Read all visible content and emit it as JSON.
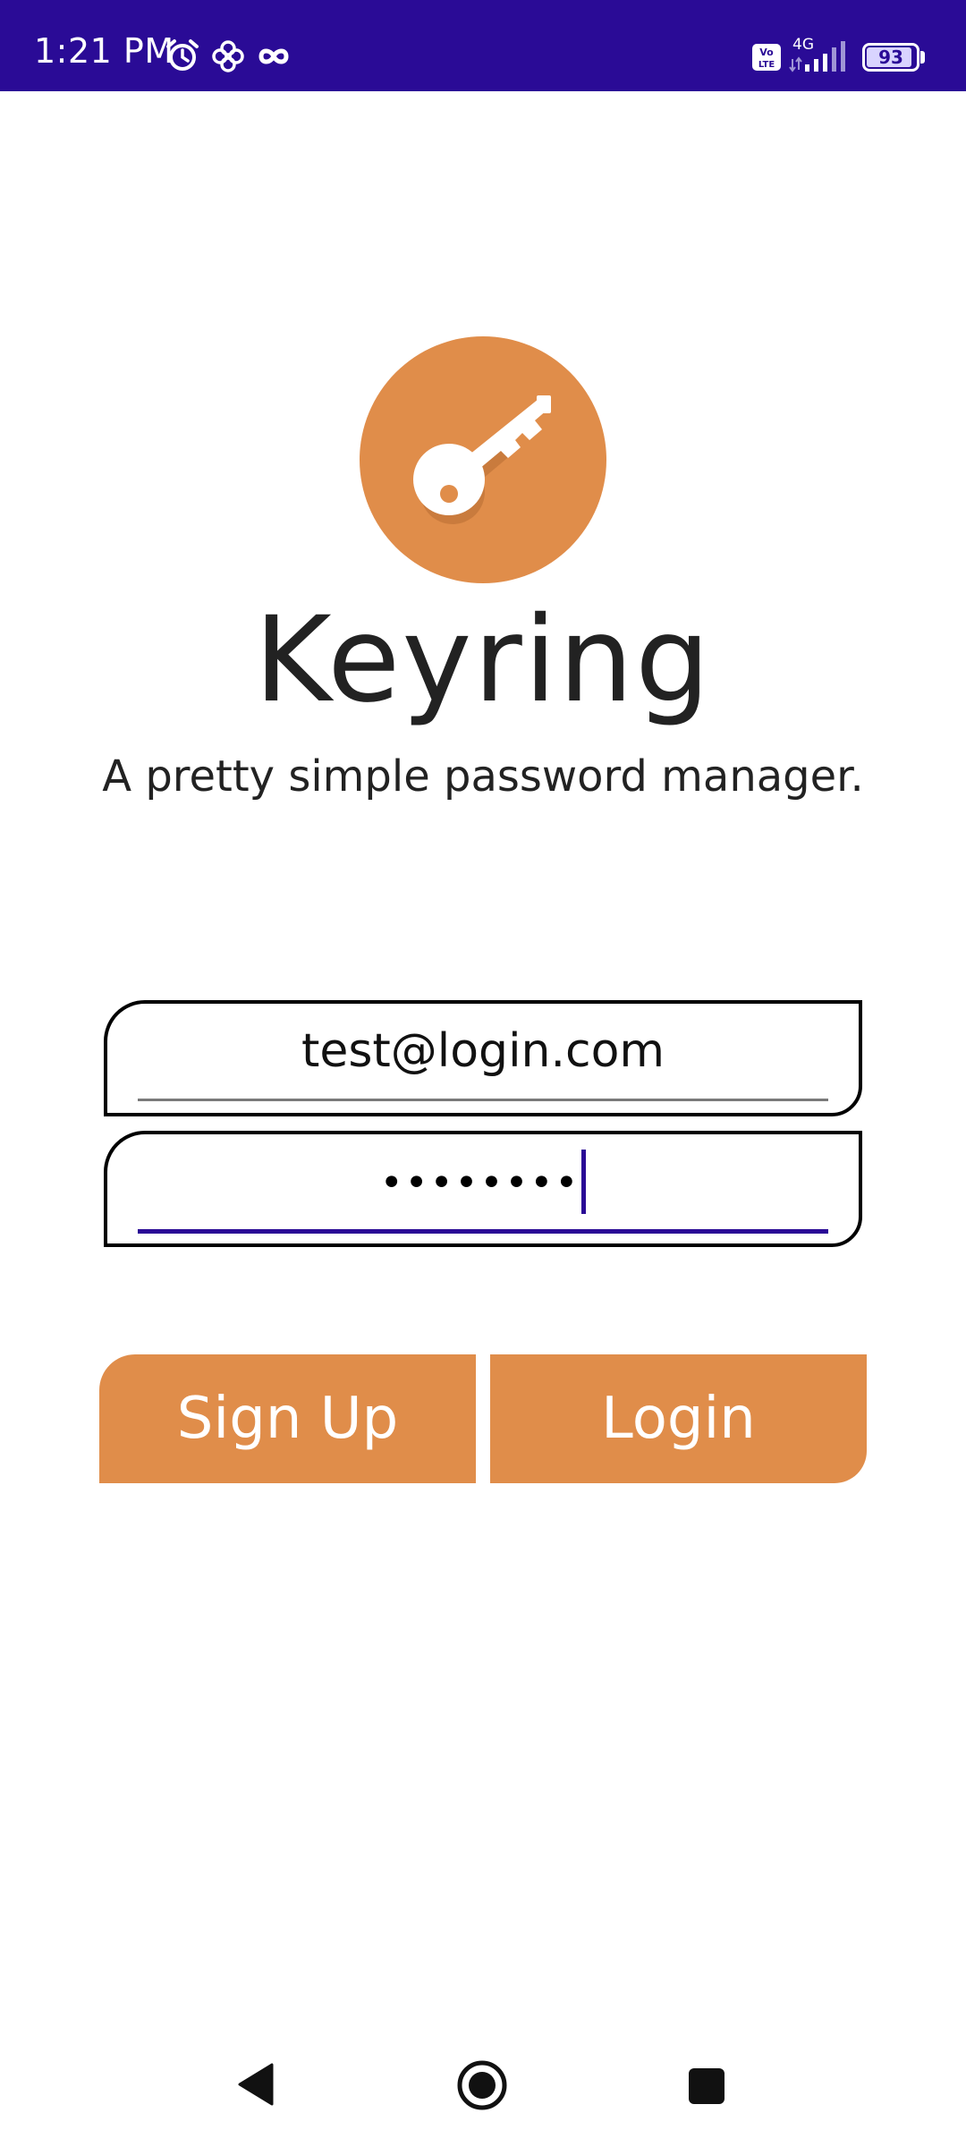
{
  "status_bar": {
    "time": "1:21 PM",
    "network": "4G",
    "volte": "Vo LTE",
    "battery_level": "93",
    "battery_fraction": 0.93,
    "background_color": "#2a0b96",
    "icons": [
      "alarm-icon",
      "pinwheel-icon",
      "infinity-icon",
      "volte-icon",
      "signal-icon",
      "battery-icon"
    ]
  },
  "app": {
    "logo_icon": "key-icon",
    "title": "Keyring",
    "subtitle": "A pretty simple password manager.",
    "accent_color": "#e08d4a"
  },
  "form": {
    "email_value": "test@login.com",
    "password_display": "••••••••",
    "focus_color": "#2a0b96"
  },
  "buttons": {
    "signup_label": "Sign Up",
    "login_label": "Login"
  },
  "nav": {
    "icons": [
      "back-icon",
      "home-icon",
      "recents-icon"
    ]
  }
}
